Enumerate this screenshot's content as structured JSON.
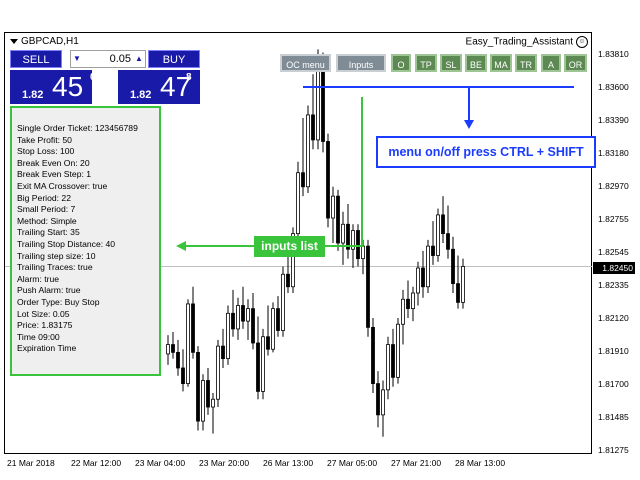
{
  "chart": {
    "symbol": "GBPCAD,H1",
    "ea_name": "Easy_Trading_Assistant",
    "current_price": "1.82450",
    "price_axis": [
      "1.83810",
      "1.83600",
      "1.83390",
      "1.83180",
      "1.82970",
      "1.82755",
      "1.82545",
      "1.82335",
      "1.82120",
      "1.81910",
      "1.81700",
      "1.81485",
      "1.81275"
    ],
    "time_axis": [
      "21 Mar 2018",
      "22 Mar 12:00",
      "23 Mar 04:00",
      "23 Mar 20:00",
      "26 Mar 13:00",
      "27 Mar 05:00",
      "27 Mar 21:00",
      "28 Mar 13:00"
    ],
    "colors": {
      "bull": "#000000",
      "bear": "#000000",
      "grid": "#c0c0c0"
    }
  },
  "one_click": {
    "sell_label": "SELL",
    "buy_label": "BUY",
    "lot_value": "0.05",
    "down_icon": "arrow-down-icon",
    "up_icon": "arrow-up-icon",
    "sell_price_small": "1.82",
    "sell_price_big": "45",
    "sell_price_sup": "0",
    "buy_price_small": "1.82",
    "buy_price_big": "47",
    "buy_price_sup": "8",
    "color": "#1a1aa8"
  },
  "menu": {
    "buttons": [
      {
        "label": "OC menu"
      },
      {
        "label": "Inputs"
      },
      {
        "label": "O"
      },
      {
        "label": "TP"
      },
      {
        "label": "SL"
      },
      {
        "label": "BE"
      },
      {
        "label": "MA"
      },
      {
        "label": "TR"
      },
      {
        "label": "A"
      },
      {
        "label": "OR"
      }
    ]
  },
  "info_panel": {
    "lines": [
      "Single Order Ticket: 123456789",
      "Take Profit: 50",
      "Stop Loss: 100",
      "Break Even On: 20",
      "Break Even Step: 1",
      "Exit MA Crossover: true",
      "Big Period: 22",
      "Small Period: 7",
      "Method: Simple",
      "Trailing Start: 35",
      "Trailing Stop Distance: 40",
      "Trailing step size: 10",
      "Trailing Traces: true",
      "Alarm: true",
      "Push Alarm: true",
      "Order Type: Buy Stop",
      "Lot Size: 0.05",
      "Price: 1.83175",
      "Time 09:00",
      "Expiration Time"
    ],
    "border_color": "#39c43b"
  },
  "annotations": {
    "menu_hint": "menu on/off press CTRL + SHIFT",
    "inputs_hint": "inputs list",
    "blue": "#1a3cff",
    "green": "#39c43b"
  },
  "candles": [
    [
      1.8189,
      1.8201,
      1.8182,
      1.8195
    ],
    [
      1.8195,
      1.8203,
      1.8186,
      1.819
    ],
    [
      1.819,
      1.8198,
      1.8175,
      1.818
    ],
    [
      1.818,
      1.8192,
      1.8165,
      1.817
    ],
    [
      1.817,
      1.8224,
      1.8168,
      1.8221
    ],
    [
      1.8221,
      1.8232,
      1.8186,
      1.819
    ],
    [
      1.819,
      1.8194,
      1.814,
      1.8146
    ],
    [
      1.8146,
      1.8176,
      1.814,
      1.8172
    ],
    [
      1.8172,
      1.818,
      1.815,
      1.8155
    ],
    [
      1.8155,
      1.8164,
      1.8138,
      1.816
    ],
    [
      1.816,
      1.8198,
      1.8155,
      1.8194
    ],
    [
      1.8194,
      1.8205,
      1.818,
      1.8186
    ],
    [
      1.8186,
      1.822,
      1.8182,
      1.8215
    ],
    [
      1.8215,
      1.823,
      1.82,
      1.8205
    ],
    [
      1.8205,
      1.8225,
      1.8198,
      1.822
    ],
    [
      1.822,
      1.8232,
      1.8205,
      1.821
    ],
    [
      1.821,
      1.8224,
      1.8198,
      1.8218
    ],
    [
      1.8218,
      1.8228,
      1.8192,
      1.8196
    ],
    [
      1.8196,
      1.8213,
      1.816,
      1.8165
    ],
    [
      1.8165,
      1.8205,
      1.816,
      1.82
    ],
    [
      1.82,
      1.822,
      1.8188,
      1.8192
    ],
    [
      1.8192,
      1.8222,
      1.819,
      1.8218
    ],
    [
      1.8218,
      1.8226,
      1.82,
      1.8204
    ],
    [
      1.8204,
      1.8245,
      1.82,
      1.824
    ],
    [
      1.824,
      1.8258,
      1.8228,
      1.8232
    ],
    [
      1.8232,
      1.827,
      1.8228,
      1.8266
    ],
    [
      1.8266,
      1.8312,
      1.8258,
      1.8305
    ],
    [
      1.8305,
      1.834,
      1.829,
      1.8296
    ],
    [
      1.8296,
      1.8348,
      1.8292,
      1.8342
    ],
    [
      1.8342,
      1.8368,
      1.832,
      1.8326
    ],
    [
      1.8326,
      1.8384,
      1.832,
      1.8378
    ],
    [
      1.8378,
      1.8382,
      1.8318,
      1.8325
    ],
    [
      1.8325,
      1.833,
      1.827,
      1.8276
    ],
    [
      1.8276,
      1.8296,
      1.826,
      1.829
    ],
    [
      1.829,
      1.8294,
      1.8255,
      1.826
    ],
    [
      1.826,
      1.828,
      1.8246,
      1.8272
    ],
    [
      1.8272,
      1.8285,
      1.825,
      1.8256
    ],
    [
      1.8256,
      1.8272,
      1.8244,
      1.8268
    ],
    [
      1.8268,
      1.8272,
      1.8245,
      1.825
    ],
    [
      1.825,
      1.8262,
      1.824,
      1.8258
    ],
    [
      1.8258,
      1.8262,
      1.82,
      1.8206
    ],
    [
      1.8206,
      1.8212,
      1.8164,
      1.817
    ],
    [
      1.817,
      1.8178,
      1.8142,
      1.815
    ],
    [
      1.815,
      1.8172,
      1.8136,
      1.8166
    ],
    [
      1.8166,
      1.82,
      1.816,
      1.8195
    ],
    [
      1.8195,
      1.8205,
      1.8168,
      1.8174
    ],
    [
      1.8174,
      1.8212,
      1.817,
      1.8208
    ],
    [
      1.8208,
      1.823,
      1.8195,
      1.8224
    ],
    [
      1.8224,
      1.8236,
      1.8212,
      1.8218
    ],
    [
      1.8218,
      1.8232,
      1.821,
      1.8228
    ],
    [
      1.8228,
      1.8248,
      1.822,
      1.8244
    ],
    [
      1.8244,
      1.8255,
      1.8225,
      1.8232
    ],
    [
      1.8232,
      1.8262,
      1.8228,
      1.8258
    ],
    [
      1.8258,
      1.8274,
      1.8246,
      1.8252
    ],
    [
      1.8252,
      1.8282,
      1.8248,
      1.8278
    ],
    [
      1.8278,
      1.829,
      1.826,
      1.8266
    ],
    [
      1.8266,
      1.8284,
      1.825,
      1.8256
    ],
    [
      1.8256,
      1.8264,
      1.8228,
      1.8234
    ],
    [
      1.8234,
      1.8252,
      1.8218,
      1.8222
    ],
    [
      1.8222,
      1.825,
      1.8218,
      1.8245
    ]
  ]
}
